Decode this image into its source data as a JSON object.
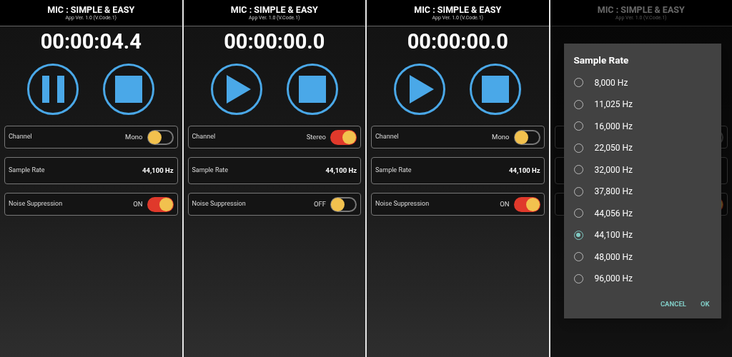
{
  "screens": [
    {
      "title": "MIC : SIMPLE & EASY",
      "version": "App Ver. 1.0 (V.Code.1)",
      "timer": "00:00:04.4",
      "buttons": [
        {
          "kind": "pause"
        },
        {
          "kind": "stop"
        }
      ],
      "dimmed": false,
      "settings": [
        {
          "kind": "toggle",
          "label": "Channel",
          "value": "Mono",
          "on": false
        },
        {
          "kind": "value",
          "label": "Sample Rate",
          "value": "44,100 Hz"
        },
        {
          "kind": "toggle",
          "label": "Noise Suppression",
          "value": "ON",
          "on": true
        }
      ]
    },
    {
      "title": "MIC : SIMPLE & EASY",
      "version": "App Ver. 1.0 (V.Code.1)",
      "timer": "00:00:00.0",
      "buttons": [
        {
          "kind": "play"
        },
        {
          "kind": "stop"
        }
      ],
      "dimmed": false,
      "settings": [
        {
          "kind": "toggle",
          "label": "Channel",
          "value": "Stereo",
          "on": true
        },
        {
          "kind": "value",
          "label": "Sample Rate",
          "value": "44,100 Hz"
        },
        {
          "kind": "toggle",
          "label": "Noise Suppression",
          "value": "OFF",
          "on": false
        }
      ]
    },
    {
      "title": "MIC : SIMPLE & EASY",
      "version": "App Ver. 1.0 (V.Code.1)",
      "timer": "00:00:00.0",
      "buttons": [
        {
          "kind": "play"
        },
        {
          "kind": "stop"
        }
      ],
      "dimmed": false,
      "settings": [
        {
          "kind": "toggle",
          "label": "Channel",
          "value": "Mono",
          "on": false
        },
        {
          "kind": "value",
          "label": "Sample Rate",
          "value": "44,100 Hz"
        },
        {
          "kind": "toggle",
          "label": "Noise Suppression",
          "value": "ON",
          "on": true
        }
      ]
    },
    {
      "title": "MIC : SIMPLE & EASY",
      "version": "App Ver. 1.0 (V.Code.1)",
      "dimmed": true,
      "settings": [
        {
          "kind": "toggle",
          "on": false
        },
        {
          "kind": "value"
        },
        {
          "kind": "toggle",
          "on": true
        }
      ],
      "dialog": {
        "title": "Sample Rate",
        "options": [
          {
            "label": "8,000 Hz",
            "selected": false
          },
          {
            "label": "11,025 Hz",
            "selected": false
          },
          {
            "label": "16,000 Hz",
            "selected": false
          },
          {
            "label": "22,050 Hz",
            "selected": false
          },
          {
            "label": "32,000 Hz",
            "selected": false
          },
          {
            "label": "37,800 Hz",
            "selected": false
          },
          {
            "label": "44,056 Hz",
            "selected": false
          },
          {
            "label": "44,100 Hz",
            "selected": true
          },
          {
            "label": "48,000 Hz",
            "selected": false
          },
          {
            "label": "96,000 Hz",
            "selected": false
          }
        ],
        "buttons": [
          "CANCEL",
          "OK"
        ]
      }
    }
  ]
}
